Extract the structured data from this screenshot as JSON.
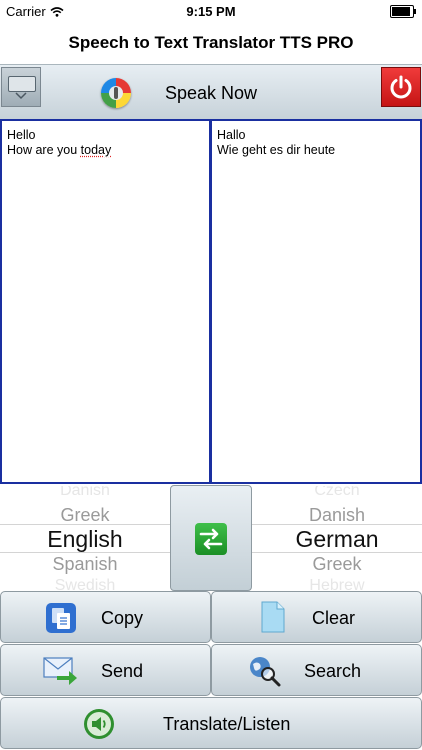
{
  "status": {
    "carrier": "Carrier",
    "time": "9:15 PM"
  },
  "title": "Speech to Text Translator TTS PRO",
  "toolbar": {
    "speak_label": "Speak Now"
  },
  "source_text": {
    "line1": "Hello",
    "line2_pre": "How are you ",
    "line2_misspelled": "today"
  },
  "target_text": {
    "line1": "Hallo",
    "line2": "Wie geht es dir heute"
  },
  "source_picker": {
    "above": "Greek",
    "selected": "English",
    "below": "Spanish",
    "faded_above": "Danish",
    "faded_below": "Swedish"
  },
  "target_picker": {
    "above": "Danish",
    "selected": "German",
    "below": "Greek",
    "faded_above": "Czech",
    "faded_below": "Hebrew"
  },
  "buttons": {
    "copy": "Copy",
    "clear": "Clear",
    "send": "Send",
    "search": "Search",
    "translate": "Translate/Listen"
  }
}
